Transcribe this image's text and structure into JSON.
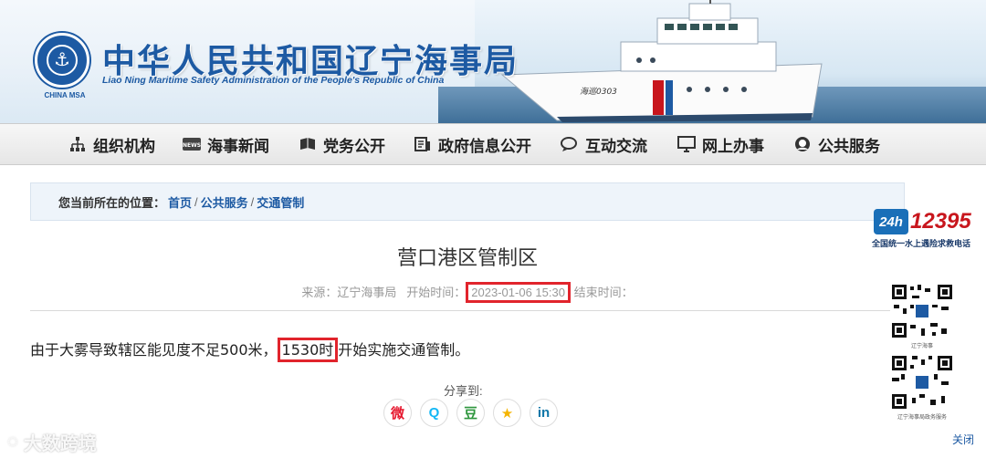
{
  "header": {
    "title_cn": "中华人民共和国辽宁海事局",
    "title_en": "Liao Ning Maritime Safety Administration of the People's Republic of China",
    "logo_caption": "CHINA MSA",
    "ship_hull_text": "海巡0303"
  },
  "nav": [
    {
      "label": "组织机构",
      "icon": "org-chart-icon"
    },
    {
      "label": "海事新闻",
      "icon": "news-icon"
    },
    {
      "label": "党务公开",
      "icon": "book-icon"
    },
    {
      "label": "政府信息公开",
      "icon": "document-icon"
    },
    {
      "label": "互动交流",
      "icon": "chat-icon"
    },
    {
      "label": "网上办事",
      "icon": "monitor-icon"
    },
    {
      "label": "公共服务",
      "icon": "person-icon"
    }
  ],
  "breadcrumb": {
    "label": "您当前所在的位置：",
    "items": [
      "首页",
      "公共服务",
      "交通管制"
    ],
    "sep": "/"
  },
  "article": {
    "title": "营口港区管制区",
    "source_label": "来源：",
    "source": "辽宁海事局",
    "start_label": "开始时间：",
    "start_time": "2023-01-06 15:30",
    "end_label": "结束时间：",
    "body_before": "由于大雾导致辖区能见度不足500米，",
    "body_highlight": "1530时",
    "body_after": "开始实施交通管制。"
  },
  "share": {
    "label": "分享到:",
    "buttons": [
      {
        "name": "weibo",
        "glyph": "微",
        "color": "#e6162d"
      },
      {
        "name": "qq",
        "glyph": "Q",
        "color": "#12b7f5"
      },
      {
        "name": "douban",
        "glyph": "豆",
        "color": "#2e963d"
      },
      {
        "name": "qzone",
        "glyph": "★",
        "color": "#f5b400"
      },
      {
        "name": "linkedin",
        "glyph": "in",
        "color": "#0e76a8"
      }
    ]
  },
  "sidebar": {
    "hotline_number": "12395",
    "hotline_badge": "24h",
    "hotline_sub": "全国统一水上遇险求救电话",
    "qr1_caption": "辽宁海事",
    "qr2_caption": "辽宁海事局政务服务"
  },
  "watermark": "大数跨境",
  "close_label": "关闭",
  "colors": {
    "brand": "#1d5aa3",
    "highlight": "#e1242c"
  }
}
